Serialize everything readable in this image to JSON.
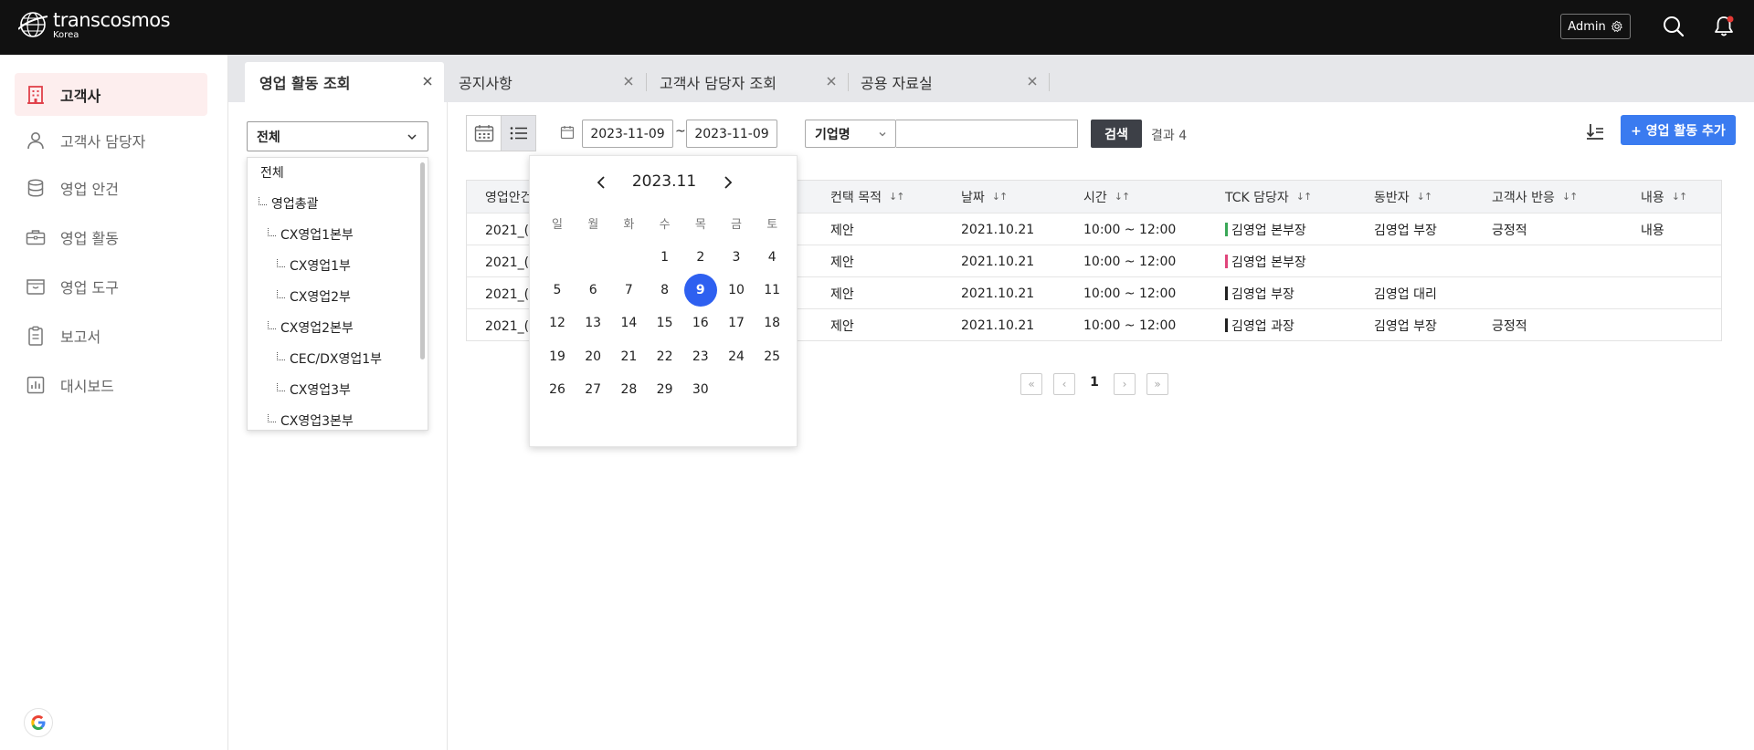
{
  "header": {
    "logo_main": "transcosmos",
    "logo_sub": "Korea",
    "admin_label": "Admin",
    "icons": [
      "search-icon",
      "bell-icon"
    ],
    "notification_dot_color": "#e53935"
  },
  "sidebar": {
    "items": [
      {
        "label": "고객사",
        "icon": "building-icon",
        "active": true
      },
      {
        "label": "고객사 담당자",
        "icon": "person-icon",
        "active": false
      },
      {
        "label": "영업 안건",
        "icon": "database-icon",
        "active": false
      },
      {
        "label": "영업 활동",
        "icon": "briefcase-icon",
        "active": false
      },
      {
        "label": "영업 도구",
        "icon": "box-icon",
        "active": false
      },
      {
        "label": "보고서",
        "icon": "clipboard-icon",
        "active": false
      },
      {
        "label": "대시보드",
        "icon": "chart-icon",
        "active": false
      }
    ],
    "google_label": "G"
  },
  "tabs": [
    {
      "label": "영업 활동 조회",
      "active": true
    },
    {
      "label": "공지사항",
      "active": false
    },
    {
      "label": "고객사 담당자 조회",
      "active": false
    },
    {
      "label": "공용 자료실",
      "active": false
    }
  ],
  "org_filter": {
    "selected": "전체",
    "options": [
      {
        "label": "전체",
        "level": 0
      },
      {
        "label": "영업총괄",
        "level": 1
      },
      {
        "label": "CX영업1본부",
        "level": 2
      },
      {
        "label": "CX영업1부",
        "level": 3
      },
      {
        "label": "CX영업2부",
        "level": 3
      },
      {
        "label": "CX영업2본부",
        "level": 2
      },
      {
        "label": "CEC/DX영업1부",
        "level": 3
      },
      {
        "label": "CX영업3부",
        "level": 3
      },
      {
        "label": "CX영업3본부",
        "level": 2
      }
    ]
  },
  "toolbar": {
    "date_from": "2023-11-09",
    "date_to": "2023-11-09",
    "date_separator": "~",
    "company_select": "기업명",
    "company_input": "",
    "search_label": "검색",
    "result_count": "결과 4",
    "add_label": "+ 영업 활동 추가",
    "accent_color": "#3a7bf0"
  },
  "calendar": {
    "title": "2023.11",
    "weekdays": [
      "일",
      "월",
      "화",
      "수",
      "목",
      "금",
      "토"
    ],
    "first_weekday": 3,
    "days_in_month": 30,
    "selected_day": 9,
    "selected_color": "#2e60f0"
  },
  "table": {
    "columns": [
      "영업안건",
      "컨택 목적",
      "날짜",
      "시간",
      "TCK 담당자",
      "동반자",
      "고객사 반응",
      "내용"
    ],
    "rows": [
      {
        "case": "2021_(주",
        "purpose": "제안",
        "date": "2021.10.21",
        "time": "10:00 ~ 12:00",
        "manager": "김영업 본부장",
        "manager_color": "#3aa757",
        "companion": "김영업 부장",
        "reaction": "긍정적",
        "content": "내용"
      },
      {
        "case": "2021_(주",
        "purpose": "제안",
        "date": "2021.10.21",
        "time": "10:00 ~ 12:00",
        "manager": "김영업 본부장",
        "manager_color": "#e0457b",
        "companion": "",
        "reaction": "",
        "content": ""
      },
      {
        "case": "2021_(주",
        "purpose": "제안",
        "date": "2021.10.21",
        "time": "10:00 ~ 12:00",
        "manager": "김영업 부장",
        "manager_color": "#222222",
        "companion": "김영업 대리",
        "reaction": "",
        "content": ""
      },
      {
        "case": "2021_(주",
        "purpose": "제안",
        "date": "2021.10.21",
        "time": "10:00 ~ 12:00",
        "manager": "김영업 과장",
        "manager_color": "#222222",
        "companion": "김영업 부장",
        "reaction": "긍정적",
        "content": ""
      }
    ]
  },
  "pagination": {
    "current": "1"
  }
}
